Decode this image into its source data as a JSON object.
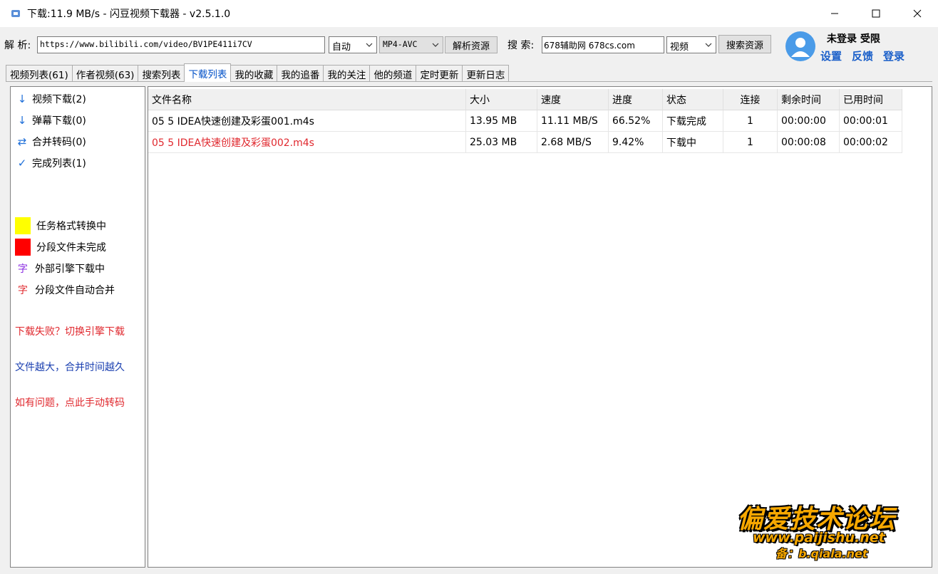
{
  "window": {
    "title": "下载:11.9 MB/s - 闪豆视频下载器 - v2.5.1.0"
  },
  "toolbar": {
    "parse_label": "解 析:",
    "url_value": "https://www.bilibili.com/video/BV1PE411i7CV",
    "mode_select": "自动",
    "format_select": "MP4-AVC",
    "parse_button": "解析资源",
    "search_label": "搜 索:",
    "search_value": "678辅助网 678cs.com",
    "search_type_select": "视频",
    "search_button": "搜索资源"
  },
  "user": {
    "status": "未登录 受限",
    "settings": "设置",
    "feedback": "反馈",
    "login": "登录"
  },
  "tabs": [
    {
      "label": "视频列表(61)"
    },
    {
      "label": "作者视频(63)"
    },
    {
      "label": "搜索列表"
    },
    {
      "label": "下载列表",
      "active": true
    },
    {
      "label": "我的收藏"
    },
    {
      "label": "我的追番"
    },
    {
      "label": "我的关注"
    },
    {
      "label": "他的频道"
    },
    {
      "label": "定时更新"
    },
    {
      "label": "更新日志"
    }
  ],
  "sidebar": {
    "items": [
      {
        "label": "视频下载(2)",
        "icon": "arrow-down-icon"
      },
      {
        "label": "弹幕下载(0)",
        "icon": "arrow-down-icon"
      },
      {
        "label": "合并转码(0)",
        "icon": "swap-icon"
      },
      {
        "label": "完成列表(1)",
        "icon": "check-icon"
      }
    ],
    "legend": [
      {
        "label": "任务格式转换中",
        "color": "#ffff00"
      },
      {
        "label": "分段文件未完成",
        "color": "#ff0000"
      },
      {
        "glyph": "字",
        "glyph_color": "#8a2be2",
        "label": "外部引擎下载中"
      },
      {
        "glyph": "字",
        "glyph_color": "#e0282e",
        "label": "分段文件自动合并"
      }
    ],
    "notes": [
      {
        "text": "下载失败？切换引擎下载",
        "color": "#e0282e"
      },
      {
        "text": "文件越大，合并时间越久",
        "color": "#1a3fb0"
      },
      {
        "text": "如有问题，点此手动转码",
        "color": "#e0282e"
      }
    ]
  },
  "grid": {
    "columns": [
      "文件名称",
      "大小",
      "速度",
      "进度",
      "状态",
      "连接",
      "剩余时间",
      "已用时间"
    ],
    "rows": [
      {
        "name": "05 5 IDEA快速创建及彩蛋001.m4s",
        "size": "13.95 MB",
        "speed": "11.11 MB/S",
        "progress": "66.52%",
        "status": "下载完成",
        "conn": "1",
        "remaining": "00:00:00",
        "elapsed": "00:00:01",
        "highlight": false
      },
      {
        "name": "05 5 IDEA快速创建及彩蛋002.m4s",
        "size": "25.03 MB",
        "speed": "2.68 MB/S",
        "progress": "9.42%",
        "status": "下载中",
        "conn": "1",
        "remaining": "00:00:08",
        "elapsed": "00:00:02",
        "highlight": true
      }
    ]
  },
  "watermark": {
    "title": "偏爱技术论坛",
    "url": "www.paijishu.net",
    "sub": "备：b.qiala.net"
  }
}
